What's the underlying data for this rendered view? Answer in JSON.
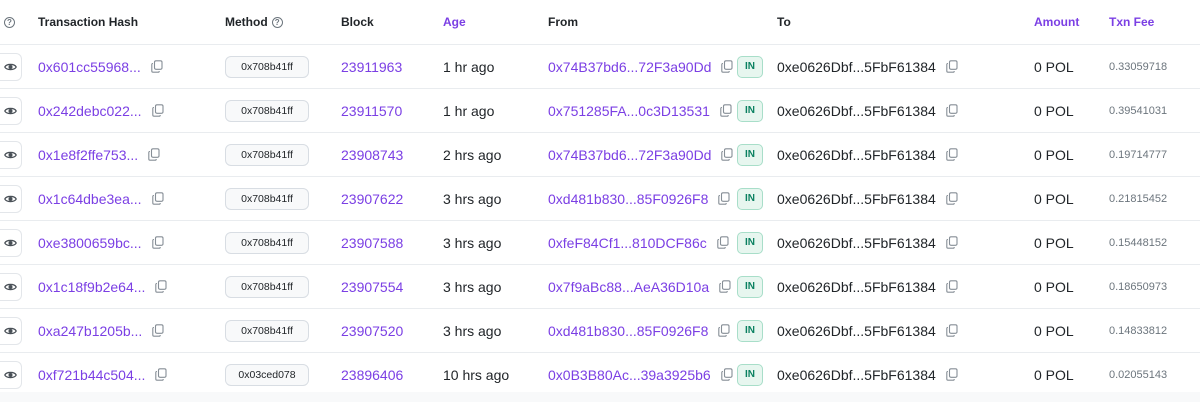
{
  "headers": {
    "hash": "Transaction Hash",
    "method": "Method",
    "block": "Block",
    "age": "Age",
    "from": "From",
    "to": "To",
    "amount": "Amount",
    "fee": "Txn Fee"
  },
  "colors": {
    "link": "#7b3fe4",
    "in_badge_bg": "#e7f6ef",
    "in_badge_text": "#0a8060"
  },
  "rows": [
    {
      "hash": "0x601cc55968...",
      "method": "0x708b41ff",
      "block": "23911963",
      "age": "1 hr ago",
      "from": "0x74B37bd6...72F3a90Dd",
      "dir": "IN",
      "to": "0xe0626Dbf...5FbF61384",
      "amount": "0 POL",
      "fee": "0.33059718"
    },
    {
      "hash": "0x242debc022...",
      "method": "0x708b41ff",
      "block": "23911570",
      "age": "1 hr ago",
      "from": "0x751285FA...0c3D13531",
      "dir": "IN",
      "to": "0xe0626Dbf...5FbF61384",
      "amount": "0 POL",
      "fee": "0.39541031"
    },
    {
      "hash": "0x1e8f2ffe753...",
      "method": "0x708b41ff",
      "block": "23908743",
      "age": "2 hrs ago",
      "from": "0x74B37bd6...72F3a90Dd",
      "dir": "IN",
      "to": "0xe0626Dbf...5FbF61384",
      "amount": "0 POL",
      "fee": "0.19714777"
    },
    {
      "hash": "0x1c64dbe3ea...",
      "method": "0x708b41ff",
      "block": "23907622",
      "age": "3 hrs ago",
      "from": "0xd481b830...85F0926F8",
      "dir": "IN",
      "to": "0xe0626Dbf...5FbF61384",
      "amount": "0 POL",
      "fee": "0.21815452"
    },
    {
      "hash": "0xe3800659bc...",
      "method": "0x708b41ff",
      "block": "23907588",
      "age": "3 hrs ago",
      "from": "0xfeF84Cf1...810DCF86c",
      "dir": "IN",
      "to": "0xe0626Dbf...5FbF61384",
      "amount": "0 POL",
      "fee": "0.15448152"
    },
    {
      "hash": "0x1c18f9b2e64...",
      "method": "0x708b41ff",
      "block": "23907554",
      "age": "3 hrs ago",
      "from": "0x7f9aBc88...AeA36D10a",
      "dir": "IN",
      "to": "0xe0626Dbf...5FbF61384",
      "amount": "0 POL",
      "fee": "0.18650973"
    },
    {
      "hash": "0xa247b1205b...",
      "method": "0x708b41ff",
      "block": "23907520",
      "age": "3 hrs ago",
      "from": "0xd481b830...85F0926F8",
      "dir": "IN",
      "to": "0xe0626Dbf...5FbF61384",
      "amount": "0 POL",
      "fee": "0.14833812"
    },
    {
      "hash": "0xf721b44c504...",
      "method": "0x03ced078",
      "block": "23896406",
      "age": "10 hrs ago",
      "from": "0x0B3B80Ac...39a3925b6",
      "dir": "IN",
      "to": "0xe0626Dbf...5FbF61384",
      "amount": "0 POL",
      "fee": "0.02055143"
    }
  ]
}
